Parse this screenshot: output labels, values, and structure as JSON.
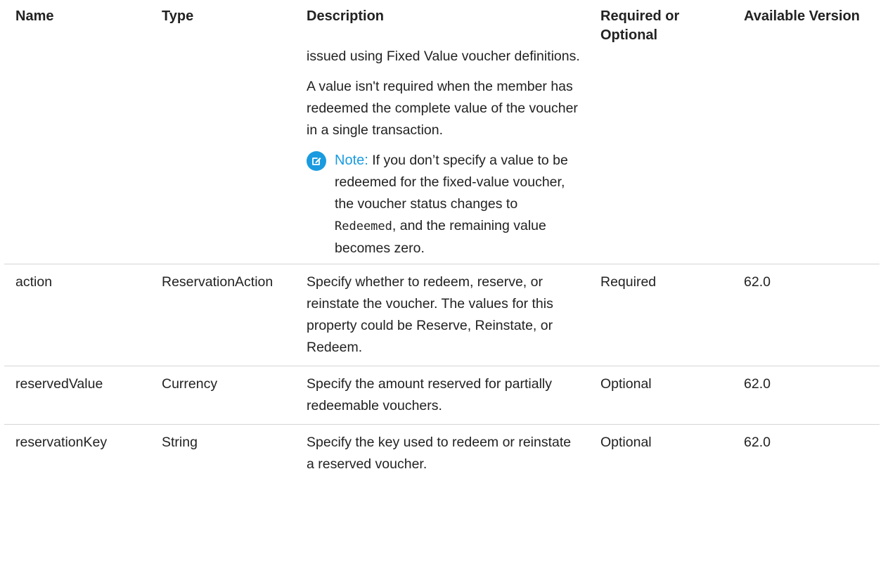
{
  "table": {
    "headers": {
      "name": "Name",
      "type": "Type",
      "description": "Description",
      "required": "Required or Optional",
      "version": "Available Version"
    },
    "continued_row": {
      "para1": "issued using Fixed Value voucher definitions.",
      "para2": "A value isn't required when the member has redeemed the complete value of the voucher in a single transaction.",
      "note": {
        "label": "Note:",
        "text_before": "If you don’t specify a value to be redeemed for the fixed-value voucher, the voucher status changes to",
        "code": "Redeemed",
        "text_after": ", and the remaining value becomes zero."
      }
    },
    "rows": [
      {
        "name": "action",
        "type": "ReservationAction",
        "description": "Specify whether to redeem, reserve, or reinstate the voucher. The values for this property could be Reserve, Reinstate, or Redeem.",
        "required": "Required",
        "version": "62.0"
      },
      {
        "name": "reservedValue",
        "type": "Currency",
        "description": "Specify the amount reserved for partially redeemable vouchers.",
        "required": "Optional",
        "version": "62.0"
      },
      {
        "name": "reservationKey",
        "type": "String",
        "description": "Specify the key used to redeem or reinstate a reserved voucher.",
        "required": "Optional",
        "version": "62.0"
      }
    ]
  },
  "icons": {
    "note": "edit-note-icon"
  },
  "colors": {
    "note_accent": "#1a9be0",
    "divider": "#d5d5d5"
  }
}
